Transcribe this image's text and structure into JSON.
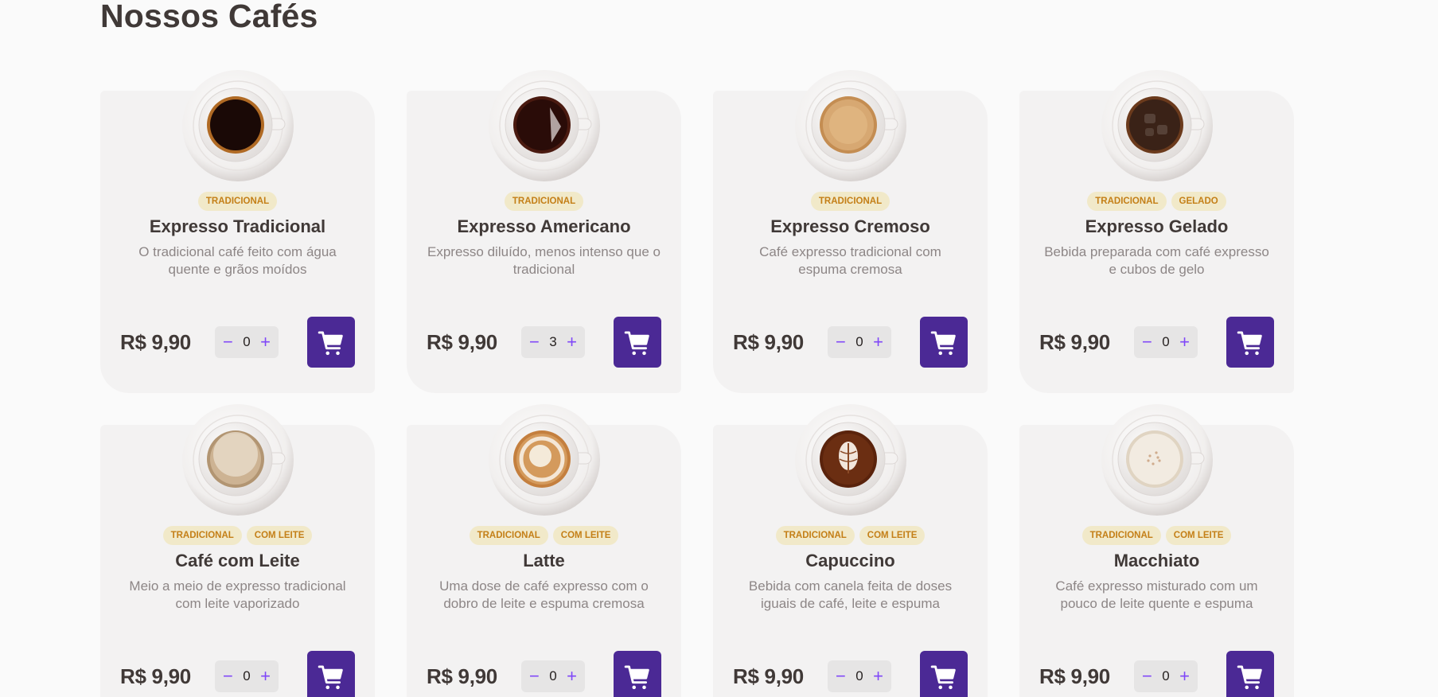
{
  "section": {
    "title": "Nossos Cafés"
  },
  "colors": {
    "background": "#fafafa",
    "card": "#f3f2f2",
    "tag_bg": "#f1e9c9",
    "tag_text": "#c47f17",
    "cart_button": "#4b2995",
    "qty_button": "#8047f8"
  },
  "icons": {
    "cart": "shopping-cart-icon",
    "minus": "minus-icon",
    "plus": "plus-icon"
  },
  "coffees": [
    {
      "name": "Expresso Tradicional",
      "description": "O tradicional café feito com água quente e grãos moídos",
      "tags": [
        "TRADICIONAL"
      ],
      "price": "R$ 9,90",
      "quantity": "0",
      "cup": {
        "coffee": "#1a0906",
        "rim": "#b06a24",
        "foam": "none"
      }
    },
    {
      "name": "Expresso Americano",
      "description": "Expresso diluído, menos intenso que o tradicional",
      "tags": [
        "TRADICIONAL"
      ],
      "price": "R$ 9,90",
      "quantity": "3",
      "cup": {
        "coffee": "#2a0c08",
        "rim": "#4a1a10",
        "foam": "none"
      }
    },
    {
      "name": "Expresso Cremoso",
      "description": "Café expresso tradicional com espuma cremosa",
      "tags": [
        "TRADICIONAL"
      ],
      "price": "R$ 9,90",
      "quantity": "0",
      "cup": {
        "coffee": "#d7a872",
        "rim": "#c48d52",
        "foam": "crema"
      }
    },
    {
      "name": "Expresso Gelado",
      "description": "Bebida preparada com café expresso e cubos de gelo",
      "tags": [
        "TRADICIONAL",
        "GELADO"
      ],
      "price": "R$ 9,90",
      "quantity": "0",
      "cup": {
        "coffee": "#3a2217",
        "rim": "#6b3a1c",
        "foam": "ice"
      }
    },
    {
      "name": "Café com Leite",
      "description": "Meio a meio de expresso tradicional com leite vaporizado",
      "tags": [
        "TRADICIONAL",
        "COM LEITE"
      ],
      "price": "R$ 9,90",
      "quantity": "0",
      "cup": {
        "coffee": "#cdb393",
        "rim": "#b29572",
        "foam": "milk"
      }
    },
    {
      "name": "Latte",
      "description": "Uma dose de café expresso com o dobro de leite e espuma cremosa",
      "tags": [
        "TRADICIONAL",
        "COM LEITE"
      ],
      "price": "R$ 9,90",
      "quantity": "0",
      "cup": {
        "coffee": "#d49a5c",
        "rim": "#c47f3e",
        "foam": "latte"
      }
    },
    {
      "name": "Capuccino",
      "description": "Bebida com canela feita de doses iguais de café, leite e espuma",
      "tags": [
        "TRADICIONAL",
        "COM LEITE"
      ],
      "price": "R$ 9,90",
      "quantity": "0",
      "cup": {
        "coffee": "#6b2e12",
        "rim": "#5a230c",
        "foam": "art"
      }
    },
    {
      "name": "Macchiato",
      "description": "Café expresso misturado com um pouco de leite quente e espuma",
      "tags": [
        "TRADICIONAL",
        "COM LEITE"
      ],
      "price": "R$ 9,90",
      "quantity": "0",
      "cup": {
        "coffee": "#f2ebe1",
        "rim": "#e0d4c2",
        "foam": "speckle"
      }
    }
  ]
}
